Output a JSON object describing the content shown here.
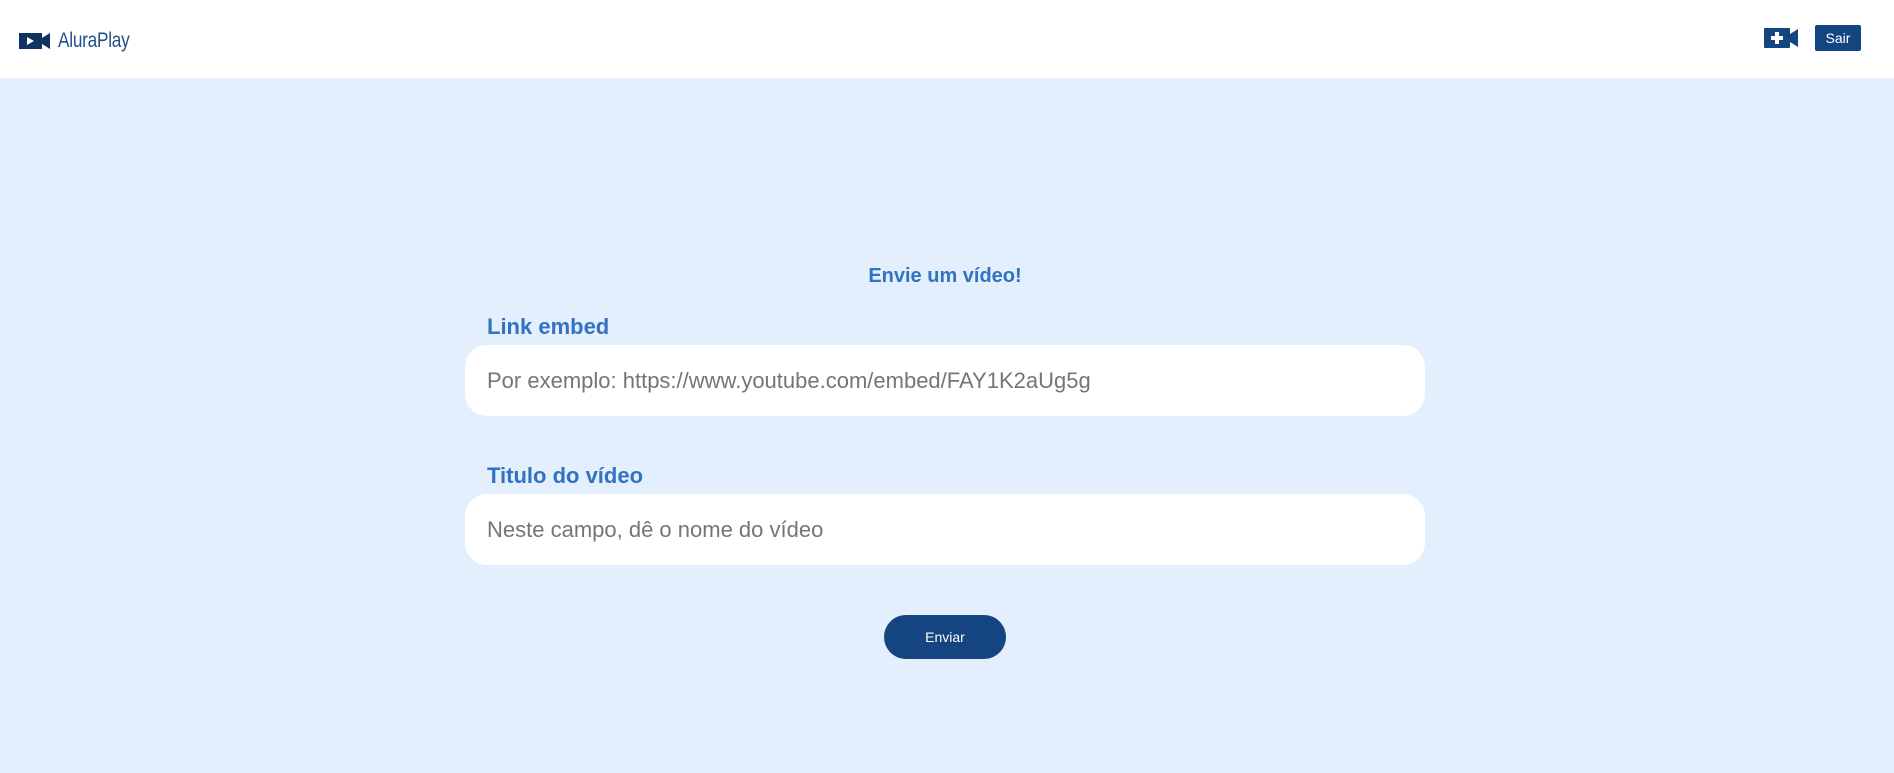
{
  "header": {
    "logo_text": "AluraPlay",
    "logo_icon": "play-camera-icon",
    "add_video_icon": "add-video-camera-icon",
    "logout_label": "Sair"
  },
  "form": {
    "title": "Envie um vídeo!",
    "link_label": "Link embed",
    "link_placeholder": "Por exemplo: https://www.youtube.com/embed/FAY1K2aUg5g",
    "link_value": "",
    "title_label": "Titulo do vídeo",
    "title_placeholder": "Neste campo, dê o nome do vídeo",
    "title_value": "",
    "submit_label": "Enviar"
  },
  "colors": {
    "background": "#e3effc",
    "header_background": "#ffffff",
    "primary_dark": "#154580",
    "accent_text": "#3272c2"
  }
}
